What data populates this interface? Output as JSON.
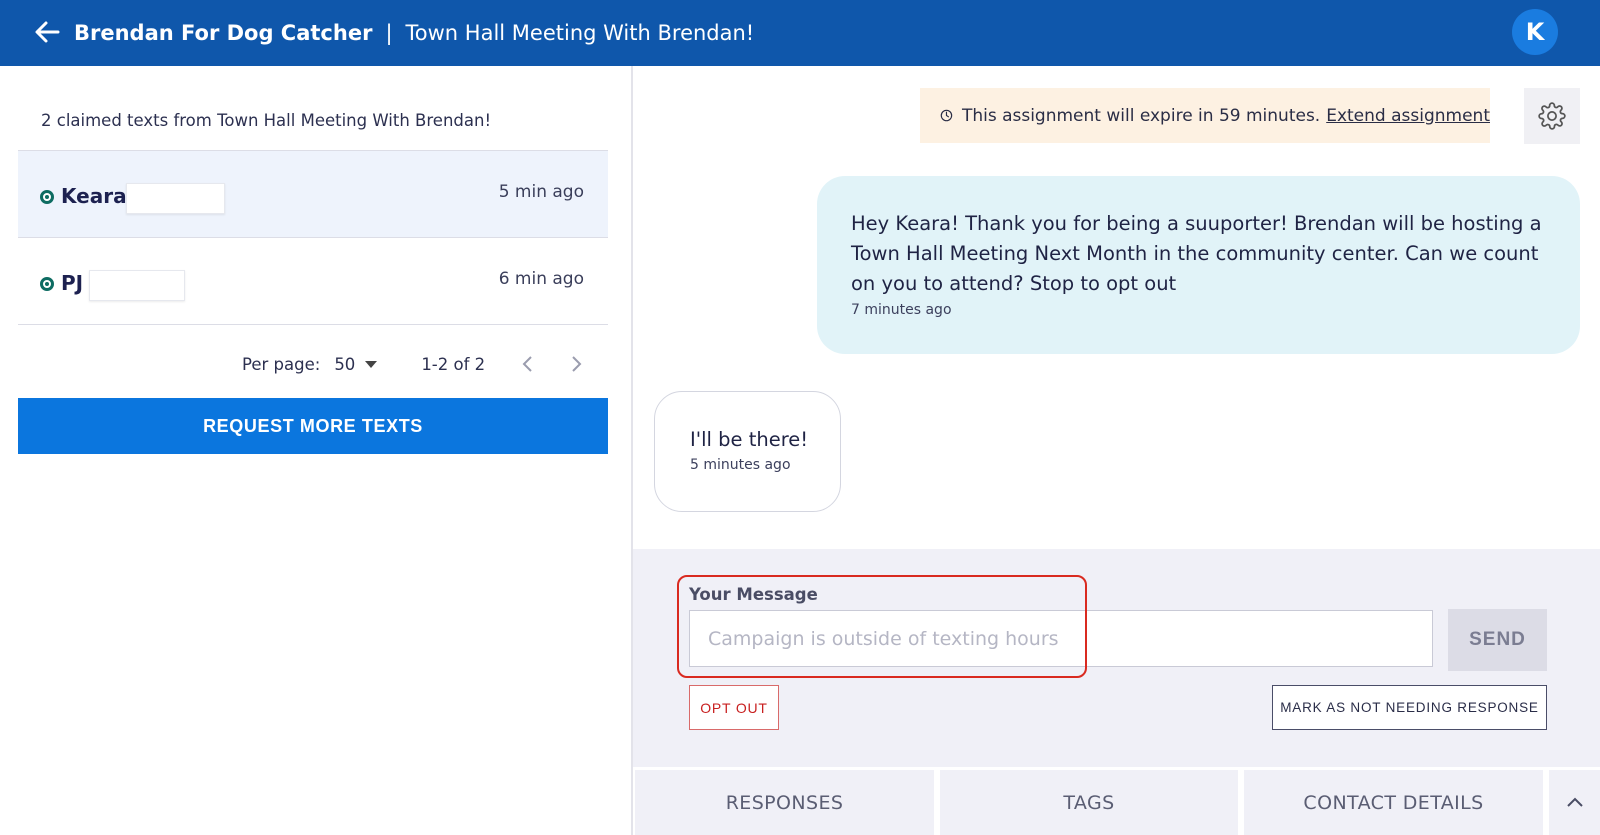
{
  "header": {
    "org_name": "Brendan For Dog Catcher",
    "separator": "|",
    "campaign_name": "Town Hall Meeting With Brendan!",
    "avatar_initial": "K",
    "colors": {
      "bar": "#0f57ab",
      "avatar": "#1a7ce0"
    },
    "back_icon": "arrow-left-icon"
  },
  "sidebar": {
    "summary": "2 claimed texts from Town Hall Meeting With Brendan!",
    "contacts": [
      {
        "name": "Keara",
        "time": "5 min ago",
        "selected": true
      },
      {
        "name": "PJ",
        "time": "6 min ago",
        "selected": false
      }
    ],
    "pagination": {
      "per_page_label": "Per page:",
      "per_page_value": "50",
      "range": "1-2 of 2"
    },
    "request_button": "REQUEST MORE TEXTS",
    "button_color": "#0b76de"
  },
  "conversation": {
    "expiry": {
      "text": "This assignment will expire in 59 minutes.",
      "link": "Extend assignment"
    },
    "messages": [
      {
        "direction": "outgoing",
        "text": "Hey Keara! Thank you for being a suuporter! Brendan will be hosting a Town Hall Meeting Next Month in the community center. Can we count on you to attend? Stop to opt out",
        "time": "7 minutes ago"
      },
      {
        "direction": "incoming",
        "text": "I'll be there!",
        "time": "5 minutes ago"
      }
    ]
  },
  "composer": {
    "label": "Your Message",
    "placeholder": "Campaign is outside of texting hours",
    "value": "",
    "send_label": "SEND",
    "opt_out_label": "OPT OUT",
    "mark_label": "MARK AS NOT NEEDING RESPONSE",
    "highlight_color": "#d92a20"
  },
  "tabs": [
    {
      "label": "RESPONSES"
    },
    {
      "label": "TAGS"
    },
    {
      "label": "CONTACT DETAILS"
    }
  ]
}
